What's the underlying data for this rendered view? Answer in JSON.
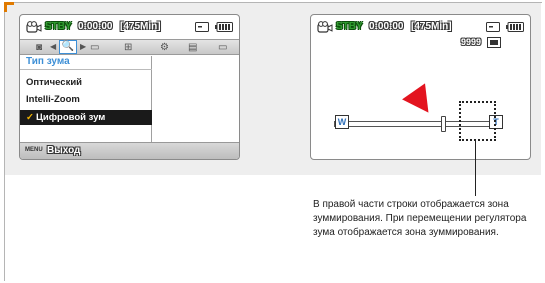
{
  "left_screen": {
    "stby": "STBY",
    "timecode": "0:00:00",
    "remaining": "[475Min]",
    "menu_title": "Тип зума",
    "menu_items": [
      {
        "label": "Оптический",
        "selected": false
      },
      {
        "label": "Intelli-Zoom",
        "selected": false
      },
      {
        "label": "Цифровой зум",
        "selected": true
      }
    ],
    "footer_menu": "MENU",
    "footer_exit": "Выход"
  },
  "right_screen": {
    "stby": "STBY",
    "timecode": "0:00:00",
    "remaining": "[475Min]",
    "photo_count": "9999",
    "wide_label": "W",
    "tele_label": "T"
  },
  "description": "В правой части строки отображается зона зуммирования. При перемещении регулятора зума отображается зона зуммирования.",
  "colors": {
    "accent_orange": "#e07a00",
    "stby_green": "#2f9c2f",
    "menu_title_blue": "#3d8fd6",
    "pointer_red": "#e3141f",
    "check_yellow": "#f2b400"
  },
  "icons": [
    "camcorder-icon",
    "card-icon",
    "battery-icon",
    "zoom-search-icon",
    "settings-gear-icon",
    "photo-icon",
    "check-icon"
  ]
}
